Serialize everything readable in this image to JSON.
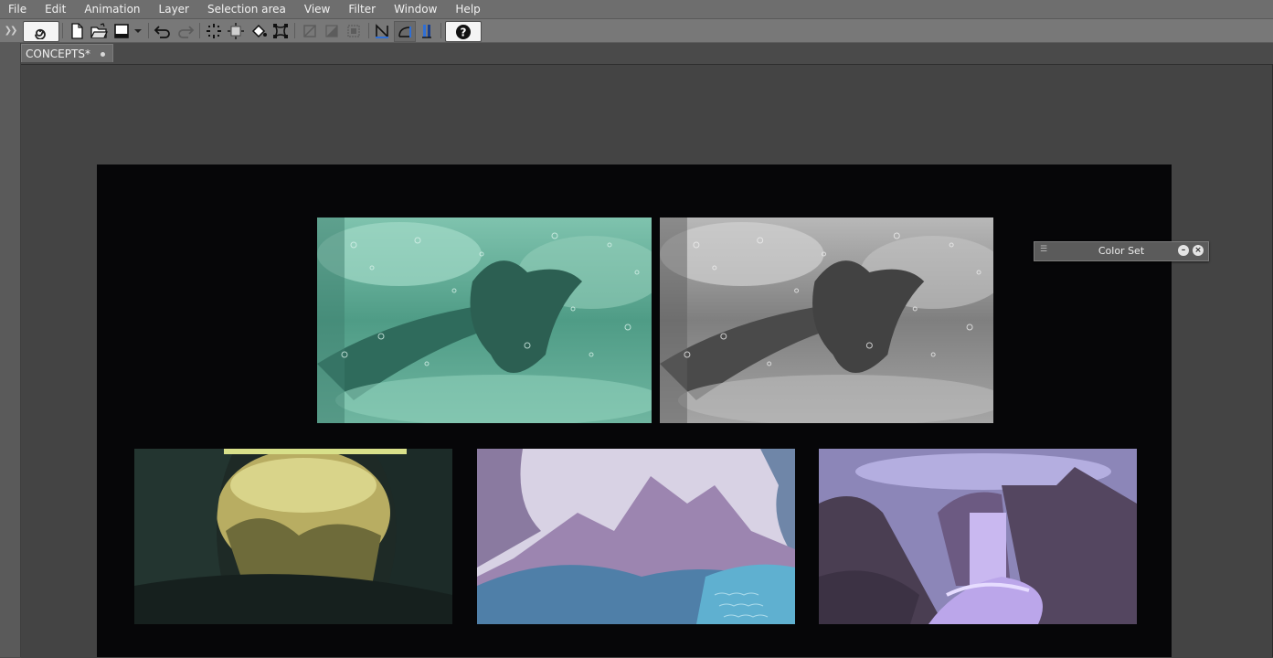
{
  "menu": {
    "items": [
      "File",
      "Edit",
      "Animation",
      "Layer",
      "Selection area",
      "View",
      "Filter",
      "Window",
      "Help"
    ]
  },
  "toolbar": {
    "icons": [
      "spiral-logo-icon",
      "new-file-icon",
      "open-file-icon",
      "save-icon",
      "dropdown-arrow-icon",
      "undo-icon",
      "redo-icon",
      "clear-icon",
      "fill-icon",
      "transform-icon",
      "selection-icon",
      "flip-icon",
      "border-icon",
      "snap-line-icon",
      "snap-angle-icon",
      "snap-ruler-icon",
      "help-icon"
    ]
  },
  "tab": {
    "label": "CONCEPTS*"
  },
  "panel": {
    "title": "Color Set"
  },
  "colors": {
    "menubar": "#6e6e6e",
    "toolbar": "#787878",
    "workspace": "#444444",
    "canvas": "#060608",
    "teal_art": "#3f8a78",
    "gray_art": "#7a7a7a",
    "cave_art": "#2a3a30",
    "mountain_art": "#8f7aa8",
    "waterfall_art": "#6a5a80",
    "snap_icon_accent": "#2f6fd6"
  }
}
